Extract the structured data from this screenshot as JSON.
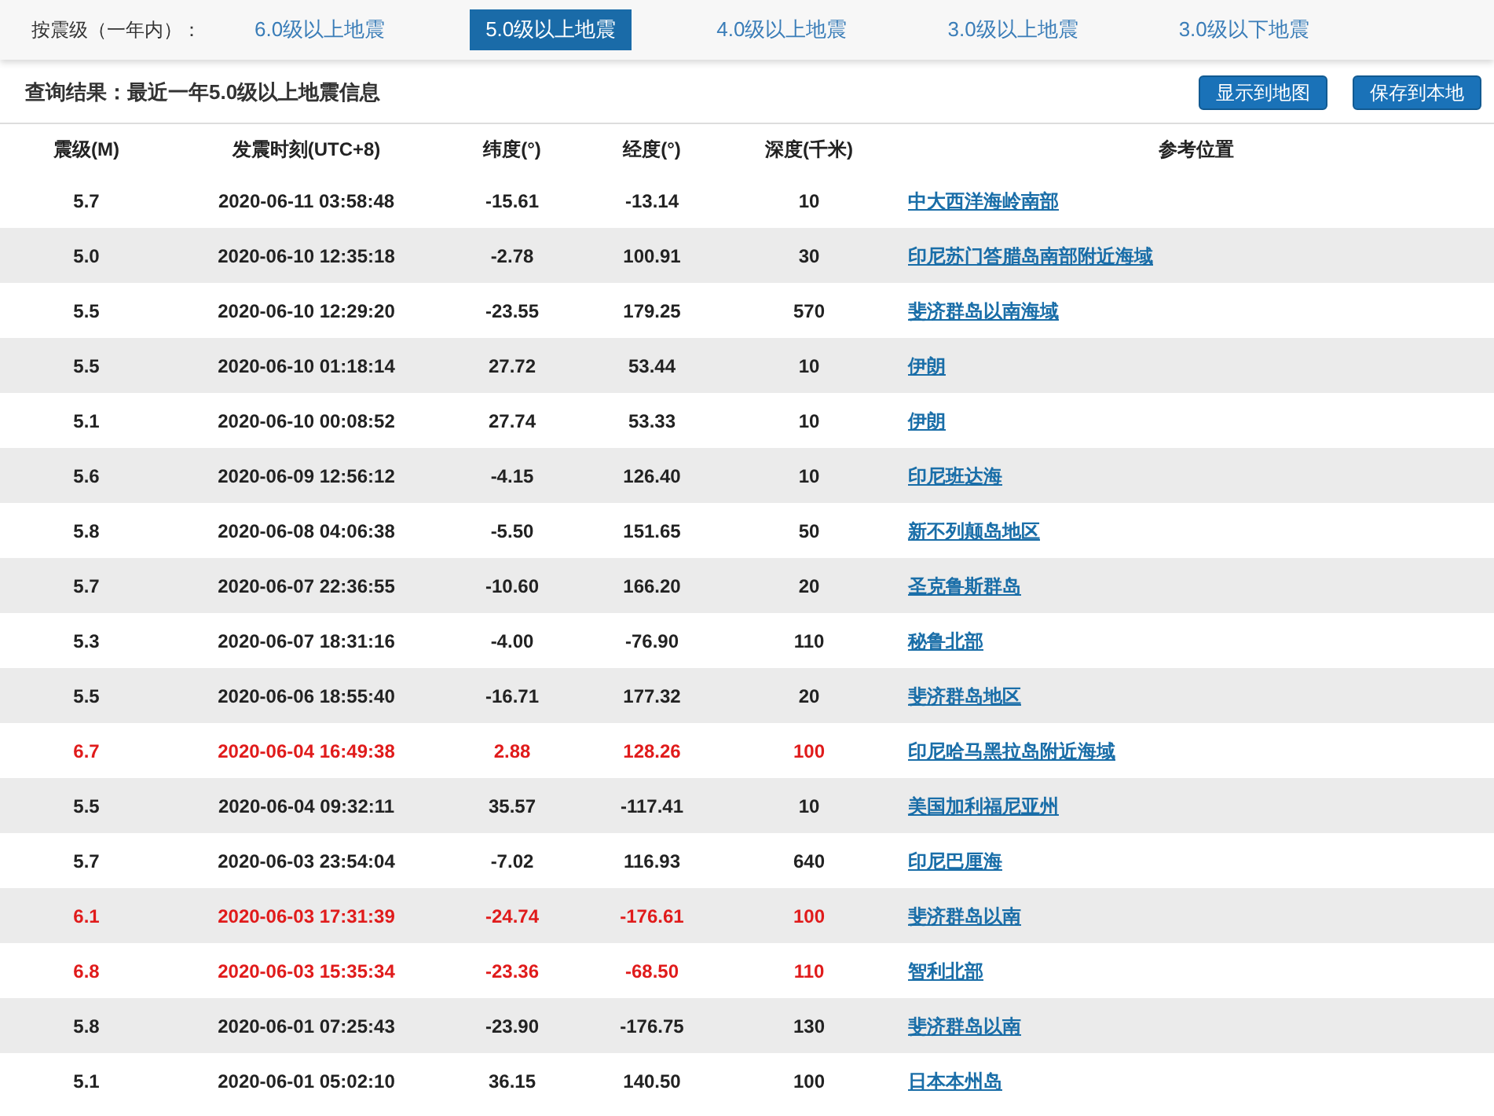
{
  "filter": {
    "label": "按震级（一年内）：",
    "options": [
      {
        "label": "6.0级以上地震",
        "selected": false
      },
      {
        "label": "5.0级以上地震",
        "selected": true
      },
      {
        "label": "4.0级以上地震",
        "selected": false
      },
      {
        "label": "3.0级以上地震",
        "selected": false
      },
      {
        "label": "3.0级以下地震",
        "selected": false
      }
    ]
  },
  "result_title": "查询结果：最近一年5.0级以上地震信息",
  "buttons": [
    "显示到地图",
    "保存到本地"
  ],
  "table": {
    "columns": [
      "震级(M)",
      "发震时刻(UTC+8)",
      "纬度(°)",
      "经度(°)",
      "深度(千米)",
      "参考位置"
    ],
    "rows": [
      {
        "magnitude": "5.7",
        "time": "2020-06-11 03:58:48",
        "lat": "-15.61",
        "lon": "-13.14",
        "depth": "10",
        "location": "中大西洋海岭南部",
        "highlight": false
      },
      {
        "magnitude": "5.0",
        "time": "2020-06-10 12:35:18",
        "lat": "-2.78",
        "lon": "100.91",
        "depth": "30",
        "location": "印尼苏门答腊岛南部附近海域",
        "highlight": false
      },
      {
        "magnitude": "5.5",
        "time": "2020-06-10 12:29:20",
        "lat": "-23.55",
        "lon": "179.25",
        "depth": "570",
        "location": "斐济群岛以南海域",
        "highlight": false
      },
      {
        "magnitude": "5.5",
        "time": "2020-06-10 01:18:14",
        "lat": "27.72",
        "lon": "53.44",
        "depth": "10",
        "location": "伊朗",
        "highlight": false
      },
      {
        "magnitude": "5.1",
        "time": "2020-06-10 00:08:52",
        "lat": "27.74",
        "lon": "53.33",
        "depth": "10",
        "location": "伊朗",
        "highlight": false
      },
      {
        "magnitude": "5.6",
        "time": "2020-06-09 12:56:12",
        "lat": "-4.15",
        "lon": "126.40",
        "depth": "10",
        "location": "印尼班达海",
        "highlight": false
      },
      {
        "magnitude": "5.8",
        "time": "2020-06-08 04:06:38",
        "lat": "-5.50",
        "lon": "151.65",
        "depth": "50",
        "location": "新不列颠岛地区",
        "highlight": false
      },
      {
        "magnitude": "5.7",
        "time": "2020-06-07 22:36:55",
        "lat": "-10.60",
        "lon": "166.20",
        "depth": "20",
        "location": "圣克鲁斯群岛",
        "highlight": false
      },
      {
        "magnitude": "5.3",
        "time": "2020-06-07 18:31:16",
        "lat": "-4.00",
        "lon": "-76.90",
        "depth": "110",
        "location": "秘鲁北部",
        "highlight": false
      },
      {
        "magnitude": "5.5",
        "time": "2020-06-06 18:55:40",
        "lat": "-16.71",
        "lon": "177.32",
        "depth": "20",
        "location": "斐济群岛地区",
        "highlight": false
      },
      {
        "magnitude": "6.7",
        "time": "2020-06-04 16:49:38",
        "lat": "2.88",
        "lon": "128.26",
        "depth": "100",
        "location": "印尼哈马黑拉岛附近海域",
        "highlight": true
      },
      {
        "magnitude": "5.5",
        "time": "2020-06-04 09:32:11",
        "lat": "35.57",
        "lon": "-117.41",
        "depth": "10",
        "location": "美国加利福尼亚州",
        "highlight": false
      },
      {
        "magnitude": "5.7",
        "time": "2020-06-03 23:54:04",
        "lat": "-7.02",
        "lon": "116.93",
        "depth": "640",
        "location": "印尼巴厘海",
        "highlight": false
      },
      {
        "magnitude": "6.1",
        "time": "2020-06-03 17:31:39",
        "lat": "-24.74",
        "lon": "-176.61",
        "depth": "100",
        "location": "斐济群岛以南",
        "highlight": true
      },
      {
        "magnitude": "6.8",
        "time": "2020-06-03 15:35:34",
        "lat": "-23.36",
        "lon": "-68.50",
        "depth": "110",
        "location": "智利北部",
        "highlight": true
      },
      {
        "magnitude": "5.8",
        "time": "2020-06-01 07:25:43",
        "lat": "-23.90",
        "lon": "-176.75",
        "depth": "130",
        "location": "斐济群岛以南",
        "highlight": false
      },
      {
        "magnitude": "5.1",
        "time": "2020-06-01 05:02:10",
        "lat": "36.15",
        "lon": "140.50",
        "depth": "100",
        "location": "日本本州岛",
        "highlight": false
      }
    ]
  }
}
